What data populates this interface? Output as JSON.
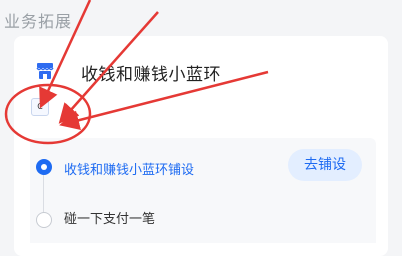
{
  "section": {
    "title": "业务拓展"
  },
  "service": {
    "title": "收钱和赚钱小蓝环",
    "badge_letter": "C",
    "icon": "shop-icon"
  },
  "steps": [
    {
      "label": "收钱和赚钱小蓝环铺设",
      "status": "active",
      "action": "去铺设"
    },
    {
      "label": "碰一下支付一笔",
      "status": "pending"
    }
  ],
  "colors": {
    "accent": "#1e6bf2",
    "annotation": "#e53935",
    "section_title": "#9aa0a6"
  }
}
